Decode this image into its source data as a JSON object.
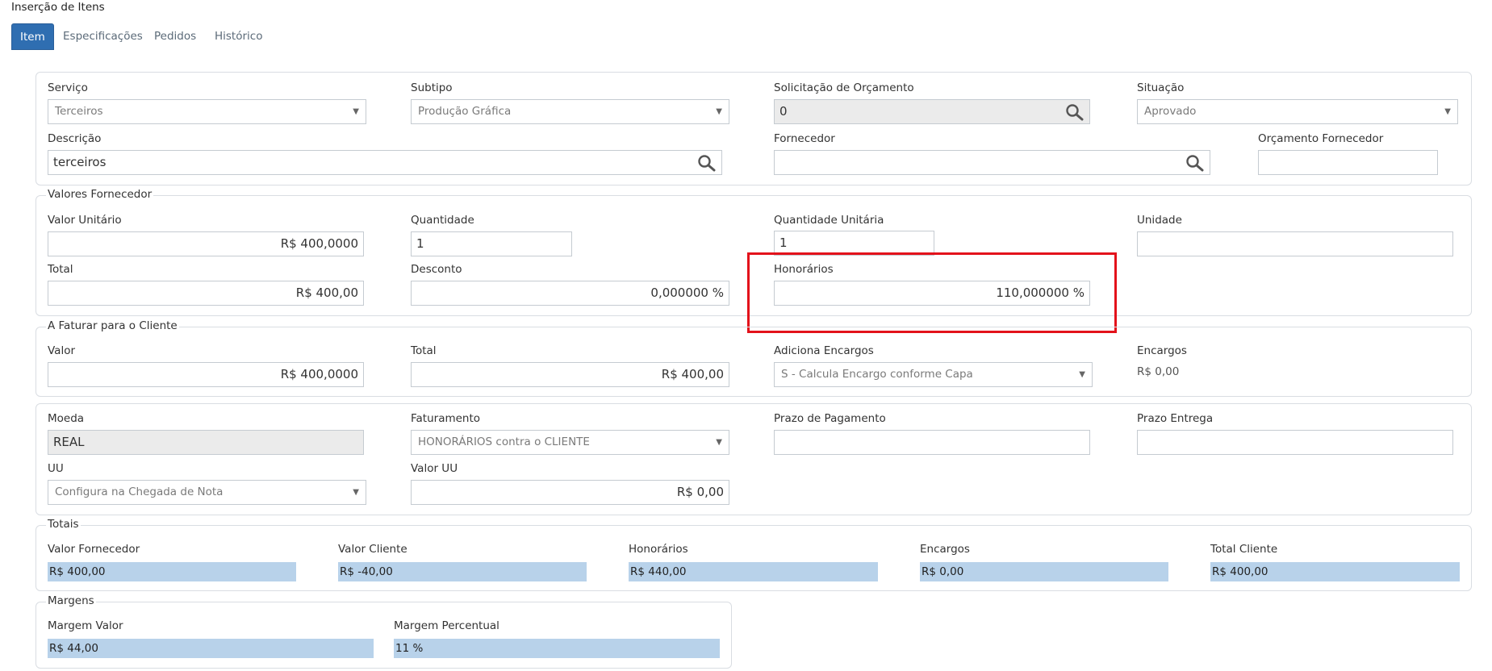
{
  "page": {
    "title": "Inserção de Itens"
  },
  "tabs": [
    {
      "label": "Item"
    },
    {
      "label": "Especificações"
    },
    {
      "label": "Pedidos"
    },
    {
      "label": "Histórico"
    }
  ],
  "general": {
    "servico": {
      "label": "Serviço",
      "value": "Terceiros"
    },
    "subtipo": {
      "label": "Subtipo",
      "value": "Produção Gráfica"
    },
    "solicitacao": {
      "label": "Solicitação de Orçamento",
      "value": "0"
    },
    "situacao": {
      "label": "Situação",
      "value": "Aprovado"
    },
    "descricao": {
      "label": "Descrição",
      "value": "terceiros"
    },
    "fornecedor": {
      "label": "Fornecedor",
      "value": ""
    },
    "orcamento_fornecedor": {
      "label": "Orçamento Fornecedor",
      "value": ""
    }
  },
  "valores_fornecedor": {
    "legend": "Valores Fornecedor",
    "valor_unitario": {
      "label": "Valor Unitário",
      "value": "R$ 400,0000"
    },
    "quantidade": {
      "label": "Quantidade",
      "value": "1"
    },
    "quantidade_unitaria": {
      "label": "Quantidade Unitária",
      "value": "1"
    },
    "unidade": {
      "label": "Unidade",
      "value": ""
    },
    "total": {
      "label": "Total",
      "value": "R$ 400,00"
    },
    "desconto": {
      "label": "Desconto",
      "value": "0,000000 %"
    },
    "honorarios": {
      "label": "Honorários",
      "value": "110,000000 %"
    }
  },
  "faturar_cliente": {
    "legend": "A Faturar para o Cliente",
    "valor": {
      "label": "Valor",
      "value": "R$ 400,0000"
    },
    "total": {
      "label": "Total",
      "value": "R$ 400,00"
    },
    "adiciona_encargos": {
      "label": "Adiciona Encargos",
      "value": "S - Calcula Encargo conforme Capa"
    },
    "encargos": {
      "label": "Encargos",
      "value": "R$ 0,00"
    }
  },
  "pagamento": {
    "moeda": {
      "label": "Moeda",
      "value": "REAL"
    },
    "faturamento": {
      "label": "Faturamento",
      "value": "HONORÁRIOS contra o CLIENTE"
    },
    "prazo_pagamento": {
      "label": "Prazo de Pagamento",
      "value": ""
    },
    "prazo_entrega": {
      "label": "Prazo Entrega",
      "value": ""
    },
    "uu": {
      "label": "UU",
      "value": "Configura na Chegada de Nota"
    },
    "valor_uu": {
      "label": "Valor UU",
      "value": "R$ 0,00"
    }
  },
  "totais": {
    "legend": "Totais",
    "items": [
      {
        "label": "Valor Fornecedor",
        "value": "R$ 400,00"
      },
      {
        "label": "Valor Cliente",
        "value": "R$ -40,00"
      },
      {
        "label": "Honorários",
        "value": "R$ 440,00"
      },
      {
        "label": "Encargos",
        "value": "R$ 0,00"
      },
      {
        "label": "Total Cliente",
        "value": "R$ 400,00"
      }
    ]
  },
  "margens": {
    "legend": "Margens",
    "margem_valor": {
      "label": "Margem Valor",
      "value": "R$ 44,00"
    },
    "margem_percentual": {
      "label": "Margem Percentual",
      "value": "11 %"
    }
  },
  "colors": {
    "tab_active": "#2f6eb1",
    "highlight": "#e3121b",
    "total_bg": "#b8d2ea"
  },
  "icons": [
    "search-icon",
    "chevron-down-icon"
  ]
}
